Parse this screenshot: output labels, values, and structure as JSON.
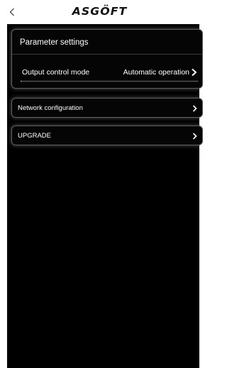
{
  "header": {
    "back_icon": "chevron-left-icon",
    "logo_text": "ASGÖFT"
  },
  "parameter_settings": {
    "title": "Parameter settings",
    "output_control_mode": {
      "label": "Output control mode",
      "value": "Automatic operation",
      "icon": "chevron-right-icon"
    }
  },
  "menu": {
    "network": {
      "label": "Network configuration",
      "icon": "chevron-right-icon"
    },
    "upgrade": {
      "label": "UPGRADE",
      "icon": "chevron-right-icon"
    }
  },
  "colors": {
    "background": "#000000",
    "header_background": "#ffffff",
    "text": "#ffffff",
    "card_border": "#5e5e5e"
  }
}
